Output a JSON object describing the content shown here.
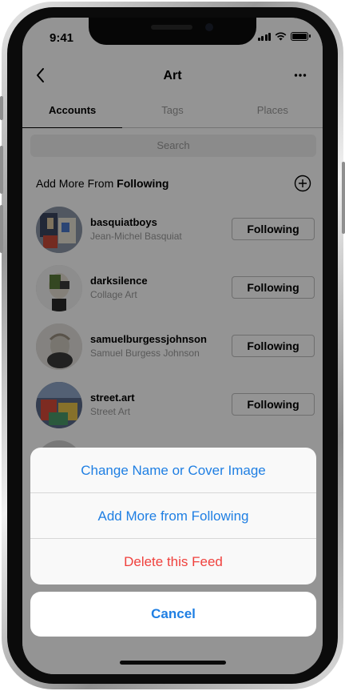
{
  "status_bar": {
    "time": "9:41"
  },
  "nav": {
    "title": "Art",
    "back_icon": "chevron-left-icon",
    "more_icon": "ellipsis-icon"
  },
  "tabs": [
    {
      "label": "Accounts",
      "active": true
    },
    {
      "label": "Tags",
      "active": false
    },
    {
      "label": "Places",
      "active": false
    }
  ],
  "search": {
    "placeholder": "Search"
  },
  "section": {
    "prefix": "Add More From ",
    "bold": "Following",
    "add_icon": "plus-circle-icon"
  },
  "accounts": [
    {
      "username": "basquiatboys",
      "name": "Jean-Michel Basquiat",
      "button": "Following"
    },
    {
      "username": "darksilence",
      "name": "Collage Art",
      "button": "Following"
    },
    {
      "username": "samuelburgessjohnson",
      "name": "Samuel Burgess Johnson",
      "button": "Following"
    },
    {
      "username": "street.art",
      "name": "Street Art",
      "button": "Following"
    }
  ],
  "action_sheet": {
    "actions": [
      {
        "label": "Change Name or Cover Image"
      },
      {
        "label": "Add More from Following"
      },
      {
        "label": "Delete this Feed",
        "destructive": true
      }
    ],
    "cancel_label": "Cancel"
  },
  "colors": {
    "action_blue": "#1f7fe3",
    "destructive_red": "#f0413d"
  }
}
